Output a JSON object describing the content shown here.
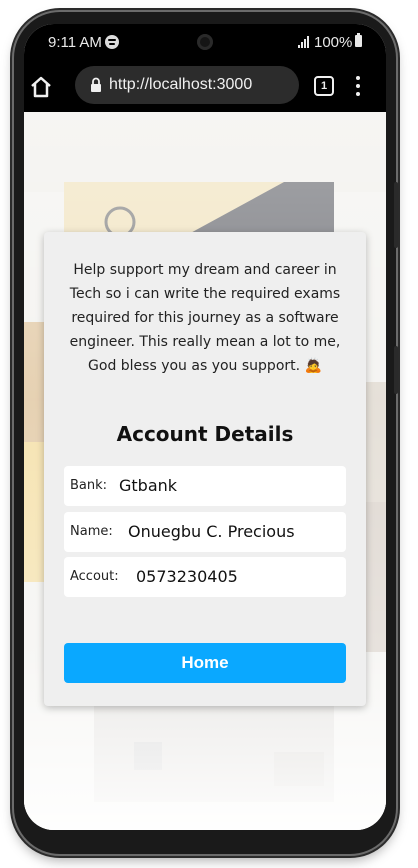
{
  "status_bar": {
    "time": "9:11 AM",
    "battery": "100%"
  },
  "browser": {
    "url": "http://localhost:3000",
    "tab_count": "1"
  },
  "card": {
    "message": "Help support my dream and career in Tech so i can write the required exams required for this journey as a software engineer. This really mean a lot to me, God bless you as you support. 🙇",
    "heading": "Account Details",
    "fields": [
      {
        "label": "Bank:",
        "value": "Gtbank"
      },
      {
        "label": "Name:",
        "value": "Onuegbu C. Precious"
      },
      {
        "label": "Accout:",
        "value": "0573230405"
      }
    ],
    "home_button": "Home"
  },
  "colors": {
    "accent": "#0aa8ff",
    "card_bg": "#efefef"
  },
  "icons": [
    "spotify-icon",
    "signal-icon",
    "battery-icon",
    "home-icon",
    "lock-icon",
    "tabs-icon",
    "more-vert-icon"
  ]
}
